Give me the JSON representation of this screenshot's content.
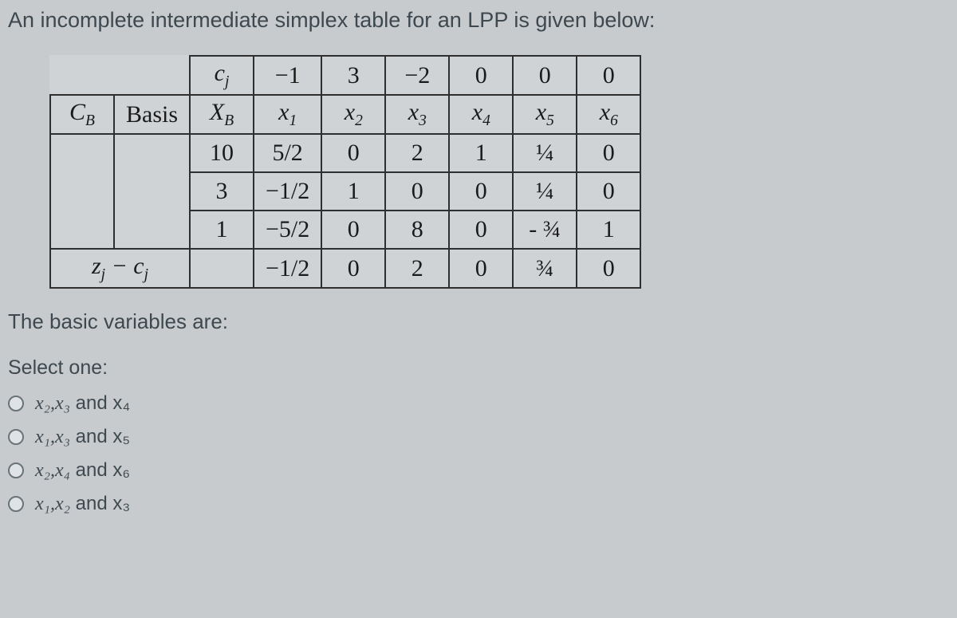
{
  "question": "An incomplete intermediate simplex table for an LPP is given below:",
  "table": {
    "cj_label": "cⱼ",
    "cj_values": [
      "−1",
      "3",
      "−2",
      "0",
      "0",
      "0"
    ],
    "headers": {
      "CB": "C_B",
      "Basis": "Basis",
      "XB": "X_B",
      "x1": "x₁",
      "x2": "x₂",
      "x3": "x₃",
      "x4": "x₄",
      "x5": "x₅",
      "x6": "x₆"
    },
    "rows": [
      {
        "XB": "10",
        "x1": "5/2",
        "x2": "0",
        "x3": "2",
        "x4": "1",
        "x5": "¼",
        "x6": "0"
      },
      {
        "XB": "3",
        "x1": "−1/2",
        "x2": "1",
        "x3": "0",
        "x4": "0",
        "x5": "¼",
        "x6": "0"
      },
      {
        "XB": "1",
        "x1": "−5/2",
        "x2": "0",
        "x3": "8",
        "x4": "0",
        "x5": "- ¾",
        "x6": "1"
      }
    ],
    "zj_cj_label": "zⱼ − cⱼ",
    "zj_cj": {
      "x1": "−1/2",
      "x2": "0",
      "x3": "2",
      "x4": "0",
      "x5": "¾",
      "x6": "0"
    }
  },
  "followup": "The basic variables are:",
  "select_label": "Select one:",
  "options": [
    {
      "text_pre": "x₂,x₃",
      "text_post": " and x₄"
    },
    {
      "text_pre": "x₁,x₃",
      "text_post": " and x₅"
    },
    {
      "text_pre": "x₂,x₄",
      "text_post": " and x₆"
    },
    {
      "text_pre": "x₁,x₂",
      "text_post": " and x₃"
    }
  ],
  "chart_data": {
    "type": "table",
    "title": "Incomplete intermediate simplex table",
    "cost_row_cj": [
      -1,
      3,
      -2,
      0,
      0,
      0
    ],
    "columns": [
      "X_B",
      "x1",
      "x2",
      "x3",
      "x4",
      "x5",
      "x6"
    ],
    "body": [
      [
        10,
        2.5,
        0,
        2,
        1,
        0.25,
        0
      ],
      [
        3,
        -0.5,
        1,
        0,
        0,
        0.25,
        0
      ],
      [
        1,
        -2.5,
        0,
        8,
        0,
        -0.75,
        1
      ]
    ],
    "zj_minus_cj": [
      -0.5,
      0,
      2,
      0,
      0.75,
      0
    ]
  }
}
